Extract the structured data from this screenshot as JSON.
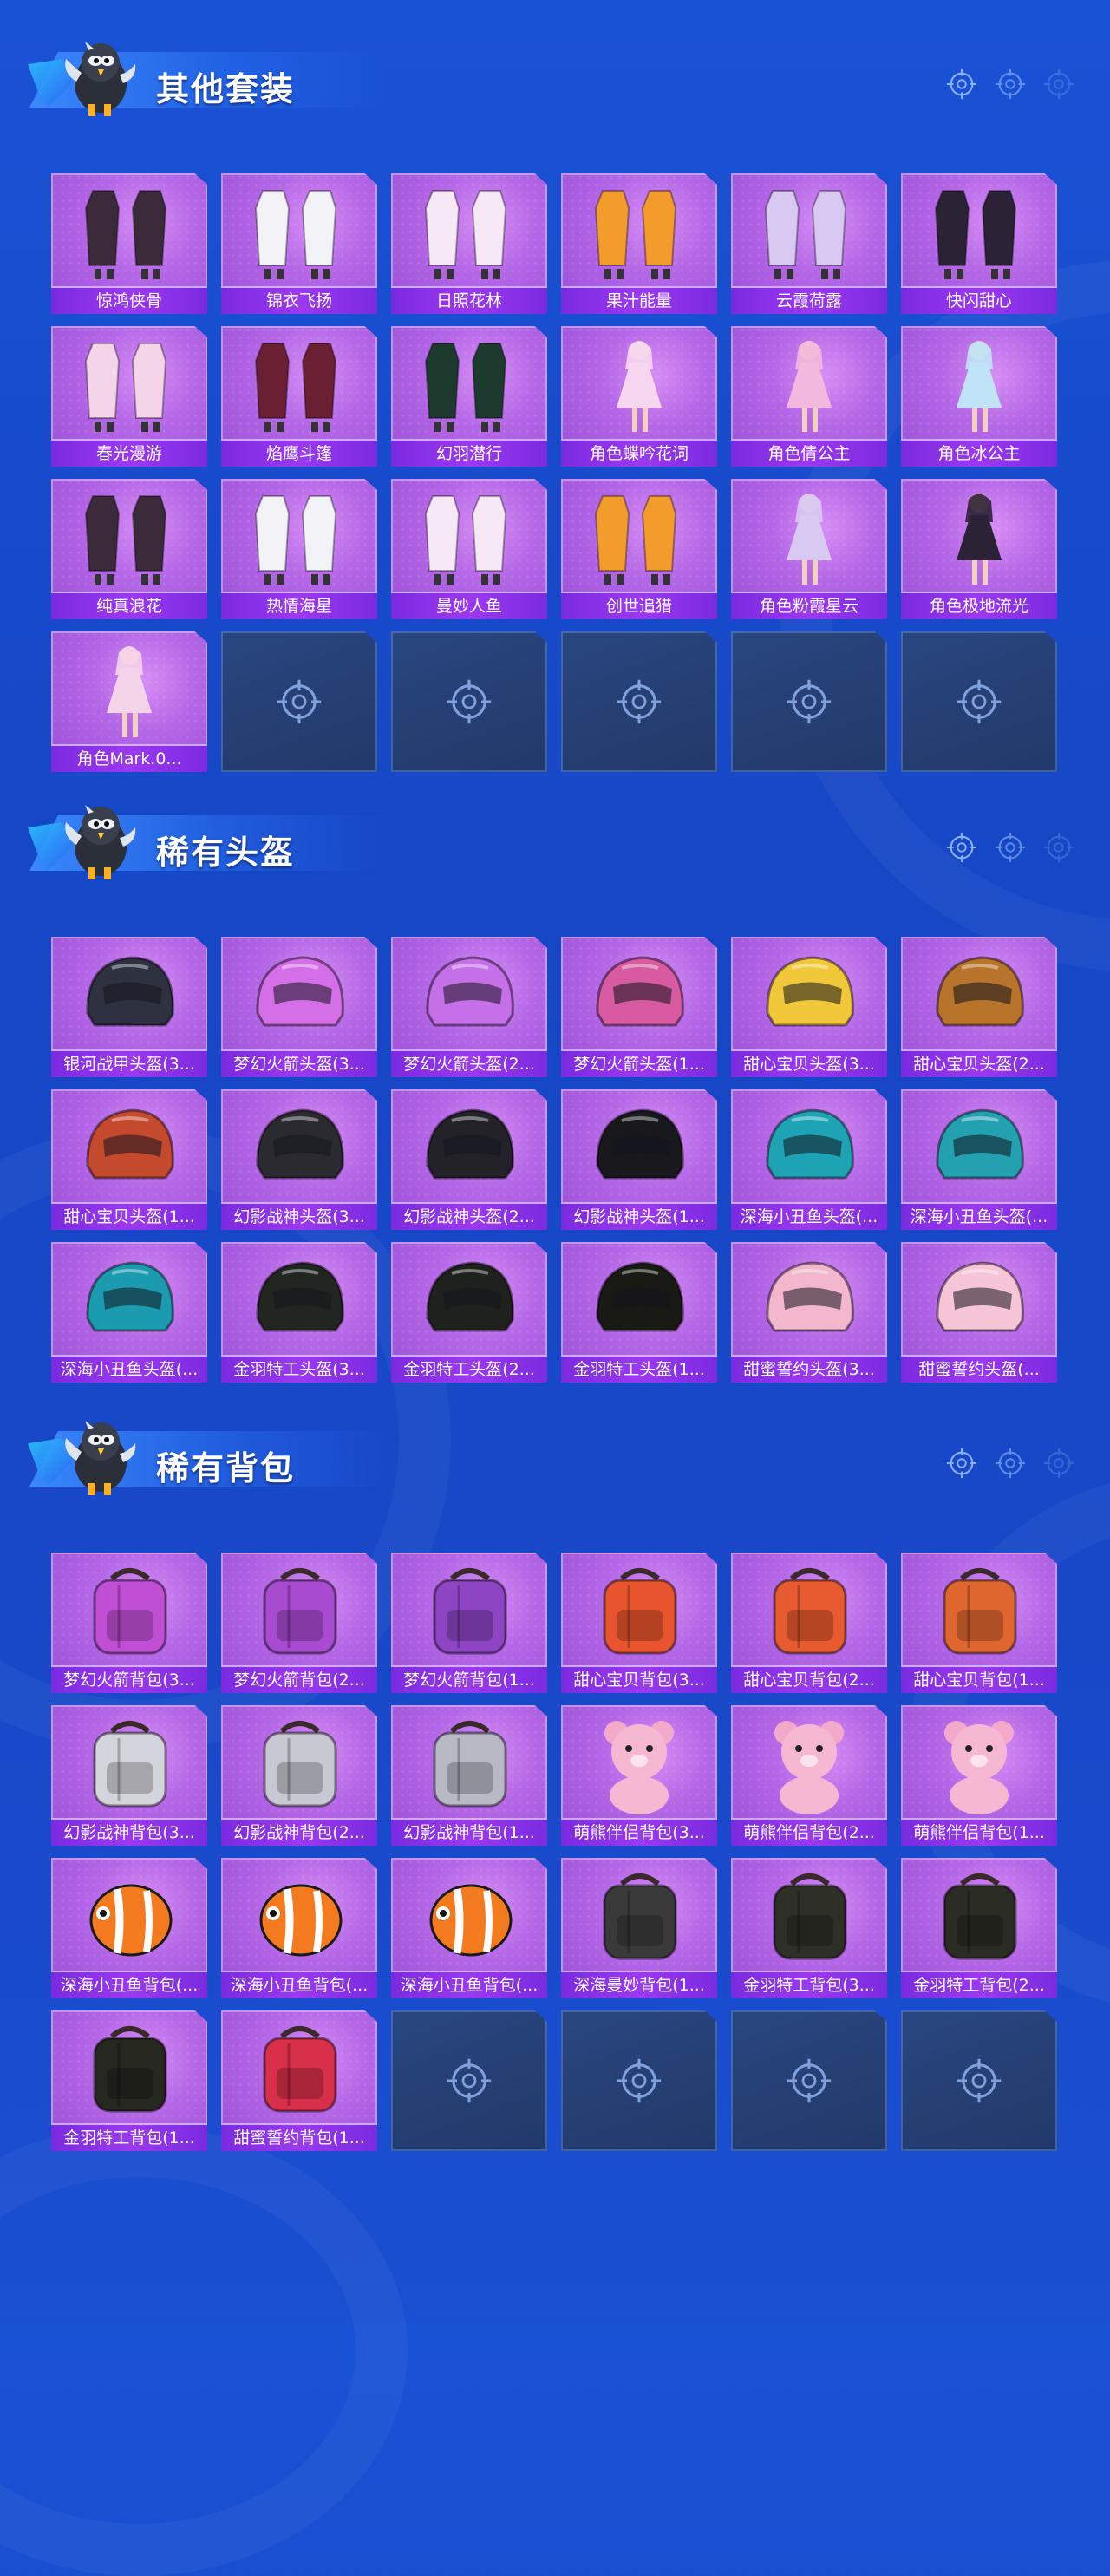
{
  "sections": [
    {
      "title": "其他套装",
      "items": [
        {
          "label": "惊鸿侠骨",
          "kind": "outfit"
        },
        {
          "label": "锦衣飞扬",
          "kind": "outfit"
        },
        {
          "label": "日照花林",
          "kind": "outfit"
        },
        {
          "label": "果汁能量",
          "kind": "outfit"
        },
        {
          "label": "云霞荷露",
          "kind": "outfit"
        },
        {
          "label": "快闪甜心",
          "kind": "outfit"
        },
        {
          "label": "春光漫游",
          "kind": "outfit"
        },
        {
          "label": "焰鹰斗篷",
          "kind": "outfit"
        },
        {
          "label": "幻羽潜行",
          "kind": "outfit"
        },
        {
          "label": "角色蝶吟花词",
          "kind": "figure"
        },
        {
          "label": "角色倩公主",
          "kind": "figure"
        },
        {
          "label": "角色冰公主",
          "kind": "figure"
        },
        {
          "label": "纯真浪花",
          "kind": "outfit"
        },
        {
          "label": "热情海星",
          "kind": "outfit"
        },
        {
          "label": "曼妙人鱼",
          "kind": "outfit"
        },
        {
          "label": "创世追猎",
          "kind": "outfit"
        },
        {
          "label": "角色粉霞星云",
          "kind": "figure"
        },
        {
          "label": "角色极地流光",
          "kind": "figure"
        },
        {
          "label": "角色Mark.0...",
          "kind": "figure"
        },
        {
          "label": "",
          "kind": "empty"
        },
        {
          "label": "",
          "kind": "empty"
        },
        {
          "label": "",
          "kind": "empty"
        },
        {
          "label": "",
          "kind": "empty"
        },
        {
          "label": "",
          "kind": "empty"
        }
      ]
    },
    {
      "title": "稀有头盔",
      "items": [
        {
          "label": "银河战甲头盔(3...",
          "kind": "helmet"
        },
        {
          "label": "梦幻火箭头盔(3...",
          "kind": "helmet"
        },
        {
          "label": "梦幻火箭头盔(2...",
          "kind": "helmet"
        },
        {
          "label": "梦幻火箭头盔(1...",
          "kind": "helmet"
        },
        {
          "label": "甜心宝贝头盔(3...",
          "kind": "helmet"
        },
        {
          "label": "甜心宝贝头盔(2...",
          "kind": "helmet"
        },
        {
          "label": "甜心宝贝头盔(1...",
          "kind": "helmet"
        },
        {
          "label": "幻影战神头盔(3...",
          "kind": "helmet"
        },
        {
          "label": "幻影战神头盔(2...",
          "kind": "helmet"
        },
        {
          "label": "幻影战神头盔(1...",
          "kind": "helmet"
        },
        {
          "label": "深海小丑鱼头盔(...",
          "kind": "helmet"
        },
        {
          "label": "深海小丑鱼头盔(...",
          "kind": "helmet"
        },
        {
          "label": "深海小丑鱼头盔(...",
          "kind": "helmet"
        },
        {
          "label": "金羽特工头盔(3...",
          "kind": "helmet"
        },
        {
          "label": "金羽特工头盔(2...",
          "kind": "helmet"
        },
        {
          "label": "金羽特工头盔(1...",
          "kind": "helmet"
        },
        {
          "label": "甜蜜誓约头盔(3...",
          "kind": "helmet"
        },
        {
          "label": "甜蜜誓约头盔(...",
          "kind": "helmet"
        }
      ]
    },
    {
      "title": "稀有背包",
      "items": [
        {
          "label": "梦幻火箭背包(3...",
          "kind": "backpack"
        },
        {
          "label": "梦幻火箭背包(2...",
          "kind": "backpack"
        },
        {
          "label": "梦幻火箭背包(1...",
          "kind": "backpack"
        },
        {
          "label": "甜心宝贝背包(3...",
          "kind": "backpack"
        },
        {
          "label": "甜心宝贝背包(2...",
          "kind": "backpack"
        },
        {
          "label": "甜心宝贝背包(1...",
          "kind": "backpack"
        },
        {
          "label": "幻影战神背包(3...",
          "kind": "backpack"
        },
        {
          "label": "幻影战神背包(2...",
          "kind": "backpack"
        },
        {
          "label": "幻影战神背包(1...",
          "kind": "backpack"
        },
        {
          "label": "萌熊伴侣背包(3...",
          "kind": "bear"
        },
        {
          "label": "萌熊伴侣背包(2...",
          "kind": "bear"
        },
        {
          "label": "萌熊伴侣背包(1...",
          "kind": "bear"
        },
        {
          "label": "深海小丑鱼背包(...",
          "kind": "fish"
        },
        {
          "label": "深海小丑鱼背包(...",
          "kind": "fish"
        },
        {
          "label": "深海小丑鱼背包(...",
          "kind": "fish"
        },
        {
          "label": "深海曼妙背包(1...",
          "kind": "backpack"
        },
        {
          "label": "金羽特工背包(3...",
          "kind": "backpack"
        },
        {
          "label": "金羽特工背包(2...",
          "kind": "backpack"
        },
        {
          "label": "金羽特工背包(1...",
          "kind": "backpack"
        },
        {
          "label": "甜蜜誓约背包(1...",
          "kind": "backpack"
        },
        {
          "label": "",
          "kind": "empty"
        },
        {
          "label": "",
          "kind": "empty"
        },
        {
          "label": "",
          "kind": "empty"
        },
        {
          "label": "",
          "kind": "empty"
        }
      ]
    }
  ],
  "colors": {
    "background": "#1a4fd2",
    "tile_fill": "#b467e6",
    "tile_label": "#8a33e8",
    "empty_tile": "#263f74"
  },
  "icons": {
    "mascot": "chicken-mascot-icon",
    "target": "crosshair-icon"
  }
}
